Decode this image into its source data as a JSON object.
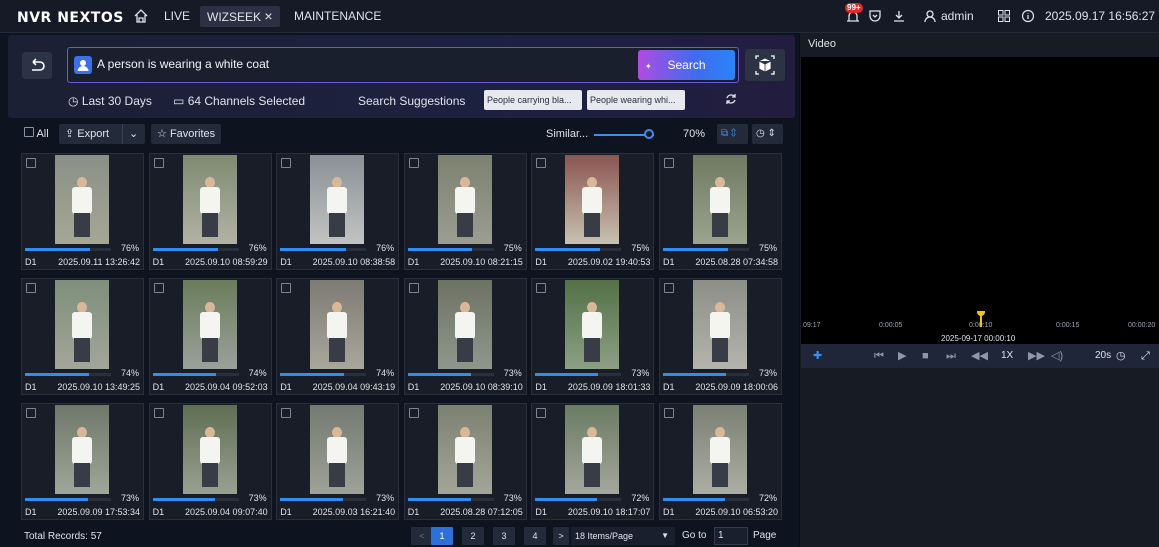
{
  "topbar": {
    "logo": "NVR NEXTOS",
    "nav": [
      {
        "label": "LIVE"
      },
      {
        "label": "WIZSEEK"
      },
      {
        "label": "MAINTENANCE"
      }
    ],
    "close_glyph": "×",
    "notification_badge": "99+",
    "user": "admin",
    "datetime": "2025.09.17 16:56:27"
  },
  "search": {
    "query": "A person is wearing a white coat",
    "button_label": "Search",
    "time_range": "Last 30 Days",
    "channels": "64 Channels Selected",
    "suggestions_label": "Search Suggestions",
    "suggestions": [
      "People carrying bla...",
      "People wearing whi..."
    ]
  },
  "toolbar": {
    "all_label": "All",
    "export_label": "Export",
    "favorites_label": "Favorites",
    "similarity_label": "Similar...",
    "similarity_value": "70%",
    "similarity_level": 0.7
  },
  "results": [
    {
      "camera": "D1",
      "time": "2025.09.11 13:26:42",
      "score": "76%",
      "score_value": 76
    },
    {
      "camera": "D1",
      "time": "2025.09.10 08:59:29",
      "score": "76%",
      "score_value": 76
    },
    {
      "camera": "D1",
      "time": "2025.09.10 08:38:58",
      "score": "76%",
      "score_value": 76
    },
    {
      "camera": "D1",
      "time": "2025.09.10 08:21:15",
      "score": "75%",
      "score_value": 75
    },
    {
      "camera": "D1",
      "time": "2025.09.02 19:40:53",
      "score": "75%",
      "score_value": 75
    },
    {
      "camera": "D1",
      "time": "2025.08.28 07:34:58",
      "score": "75%",
      "score_value": 75
    },
    {
      "camera": "D1",
      "time": "2025.09.10 13:49:25",
      "score": "74%",
      "score_value": 74
    },
    {
      "camera": "D1",
      "time": "2025.09.04 09:52:03",
      "score": "74%",
      "score_value": 74
    },
    {
      "camera": "D1",
      "time": "2025.09.04 09:43:19",
      "score": "74%",
      "score_value": 74
    },
    {
      "camera": "D1",
      "time": "2025.09.10 08:39:10",
      "score": "73%",
      "score_value": 73
    },
    {
      "camera": "D1",
      "time": "2025.09.09 18:01:33",
      "score": "73%",
      "score_value": 73
    },
    {
      "camera": "D1",
      "time": "2025.09.09 18:00:06",
      "score": "73%",
      "score_value": 73
    },
    {
      "camera": "D1",
      "time": "2025.09.09 17:53:34",
      "score": "73%",
      "score_value": 73
    },
    {
      "camera": "D1",
      "time": "2025.09.04 09:07:40",
      "score": "73%",
      "score_value": 73
    },
    {
      "camera": "D1",
      "time": "2025.09.03 16:21:40",
      "score": "73%",
      "score_value": 73
    },
    {
      "camera": "D1",
      "time": "2025.08.28 07:12:05",
      "score": "73%",
      "score_value": 73
    },
    {
      "camera": "D1",
      "time": "2025.09.10 18:17:07",
      "score": "72%",
      "score_value": 72
    },
    {
      "camera": "D1",
      "time": "2025.09.10 06:53:20",
      "score": "72%",
      "score_value": 72
    }
  ],
  "footer": {
    "total": "Total Records: 57",
    "pages": [
      "1",
      "2",
      "3",
      "4"
    ],
    "prev_glyph": "<",
    "next_glyph": ">",
    "per_page": "18 Items/Page",
    "goto_label": "Go to",
    "goto_value": "1",
    "page_label": "Page"
  },
  "video": {
    "title": "Video",
    "timeline_labels": [
      "09:17",
      "0:00:05",
      "0:00:10",
      "0:00:15",
      "00:00:20"
    ],
    "timeline_date": "2025-09-17 00:00:10",
    "speed": "1X",
    "clip_length": "20s"
  },
  "colors": {
    "accent": "#2f8ef2",
    "search_gradient_start": "#b04ce0",
    "cursor": "#f0c21a"
  }
}
